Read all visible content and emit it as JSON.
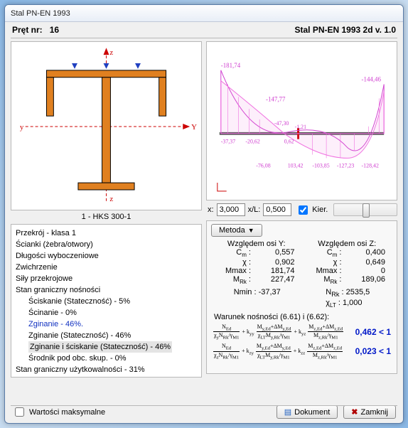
{
  "window": {
    "title": "Stal PN-EN 1993"
  },
  "header": {
    "left_label": "Pręt nr:",
    "left_value": "16",
    "right": "Stal PN-EN 1993 2d v. 1.0"
  },
  "cross_section": {
    "caption": "1 - HKS 300-1",
    "axis_y_left": "y",
    "axis_y_right": "Y",
    "axis_z_top": "z",
    "axis_z_bottom": "z"
  },
  "diagram": {
    "labels": [
      "-181,74",
      "-144,46",
      "-147,77",
      "-47,30",
      "-1,21",
      "-37,37",
      "-20,62",
      "0,62",
      "-76,08",
      "103,42",
      "-103,85",
      "-127,23",
      "-128,42"
    ]
  },
  "coord": {
    "x_label": "x:",
    "x_value": "3,000",
    "xl_label": "x/L:",
    "xl_value": "0,500",
    "kier_label": "Kier."
  },
  "tree": {
    "items": [
      {
        "t": "Przekrój - klasa 1",
        "i": 0
      },
      {
        "t": "Ścianki (żebra/otwory)",
        "i": 0
      },
      {
        "t": "Długości wyboczeniowe",
        "i": 0
      },
      {
        "t": "Zwichrzenie",
        "i": 0
      },
      {
        "t": "Siły przekrojowe",
        "i": 0
      },
      {
        "t": "Stan graniczny nośności",
        "i": 0
      },
      {
        "t": "Ściskanie (Stateczność) - 5%",
        "i": 1
      },
      {
        "t": "Ścinanie - 0%",
        "i": 1
      },
      {
        "t": "Zginanie - 46%.",
        "i": 1,
        "sel": "blue"
      },
      {
        "t": "Zginanie (Stateczność) - 46%",
        "i": 1
      },
      {
        "t": "Zginanie i ściskanie (Stateczność) - 46%",
        "i": 1,
        "sel": "grey"
      },
      {
        "t": "Środnik pod obc. skup. - 0%",
        "i": 1
      },
      {
        "t": "Stan graniczny użytkowalności - 31%",
        "i": 0
      }
    ]
  },
  "method_button": "Metoda",
  "axisY": {
    "title": "Względem osi Y:",
    "rows": [
      [
        "C",
        "m",
        "0,557"
      ],
      [
        "χ",
        "",
        "0,902"
      ],
      [
        "Mmax",
        "",
        "181,74"
      ],
      [
        "M",
        "Rk",
        "227,47"
      ]
    ]
  },
  "axisZ": {
    "title": "Względem osi Z:",
    "rows": [
      [
        "C",
        "m",
        "0,400"
      ],
      [
        "χ",
        "",
        "0,649"
      ],
      [
        "Mmax",
        "",
        "0"
      ],
      [
        "M",
        "Rk",
        "189,06"
      ]
    ]
  },
  "nmin": {
    "label": "Nmin :",
    "value": "-37,37"
  },
  "nrk": {
    "label": "N",
    "sub": "Rk",
    "value": "2535,5"
  },
  "chi_lt": {
    "label": "χ",
    "sub": "LT",
    "value": "1,000"
  },
  "condition_title": "Warunek nośności (6.61) i (6.62):",
  "results": [
    {
      "value": "0,462 < 1"
    },
    {
      "value": "0,023 < 1"
    }
  ],
  "bottom": {
    "checkbox": "Wartości maksymalne",
    "document": "Dokument",
    "close": "Zamknij"
  }
}
